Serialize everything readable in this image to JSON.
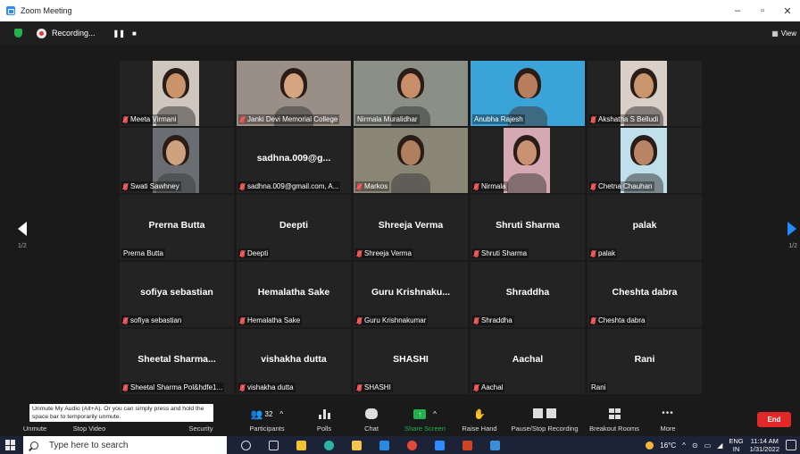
{
  "window": {
    "title": "Zoom Meeting",
    "controls": [
      "–",
      "▫",
      "✕"
    ]
  },
  "meeting_bar": {
    "recording_label": "Recording...",
    "view_label": "View"
  },
  "gallery": {
    "page_left": "1/2",
    "page_right": "1/2",
    "tiles": [
      {
        "big": "",
        "label": "Meeta Virmani",
        "muted": true,
        "video": "narrow",
        "bg": "#cfc6bd",
        "face": "#c9946a"
      },
      {
        "big": "",
        "label": "Janki Devi Memorial College",
        "muted": true,
        "video": "wide",
        "bg": "#9a8f86",
        "face": "#d6a57f"
      },
      {
        "big": "",
        "label": "Nirmala Muralidhar",
        "muted": false,
        "video": "wide",
        "bg": "#8b8f86",
        "face": "#c98d6a",
        "highlight": true
      },
      {
        "big": "",
        "label": "Anubha Rajesh",
        "muted": false,
        "video": "wide",
        "bg": "#3aa3d8",
        "face": "#b67e5d"
      },
      {
        "big": "",
        "label": "Akshatha S Belludi",
        "muted": true,
        "video": "narrow",
        "bg": "#d9cfc7",
        "face": "#c8956c"
      },
      {
        "big": "",
        "label": "Swati Sawhney",
        "muted": true,
        "video": "narrow",
        "bg": "#6a6d72",
        "face": "#cfa27f"
      },
      {
        "big": "sadhna.009@g...",
        "label": "sadhna.009@gmail.com, A...",
        "muted": true,
        "video": "none"
      },
      {
        "big": "",
        "label": "Markos",
        "muted": true,
        "video": "wide",
        "bg": "#8a8676",
        "face": "#b07f5f"
      },
      {
        "big": "",
        "label": "Nirmala",
        "muted": true,
        "video": "narrow",
        "bg": "#d6a8b3",
        "face": "#c99273"
      },
      {
        "big": "",
        "label": "Chetna Chauhan",
        "muted": true,
        "video": "narrow",
        "bg": "#bfe0ea",
        "face": "#b98566"
      },
      {
        "big": "Prerna Butta",
        "label": "Prerna Butta",
        "muted": false,
        "video": "none"
      },
      {
        "big": "Deepti",
        "label": "Deepti",
        "muted": true,
        "video": "none"
      },
      {
        "big": "Shreeja Verma",
        "label": "Shreeja Verma",
        "muted": true,
        "video": "none"
      },
      {
        "big": "Shruti Sharma",
        "label": "Shruti Sharma",
        "muted": true,
        "video": "none"
      },
      {
        "big": "palak",
        "label": "palak",
        "muted": true,
        "video": "none"
      },
      {
        "big": "sofiya sebastian",
        "label": "sofiya sebastian",
        "muted": true,
        "video": "none"
      },
      {
        "big": "Hemalatha Sake",
        "label": "Hemalatha Sake",
        "muted": true,
        "video": "none"
      },
      {
        "big": "Guru Krishnaku...",
        "label": "Guru Krishnakumar",
        "muted": true,
        "video": "none"
      },
      {
        "big": "Shraddha",
        "label": "Shraddha",
        "muted": true,
        "video": "none"
      },
      {
        "big": "Cheshta dabra",
        "label": "Cheshta dabra",
        "muted": true,
        "video": "none"
      },
      {
        "big": "Sheetal Sharma...",
        "label": "Sheetal Sharma Pol&hdfe1...",
        "muted": true,
        "video": "none"
      },
      {
        "big": "vishakha dutta",
        "label": "vishakha dutta",
        "muted": true,
        "video": "none"
      },
      {
        "big": "SHASHI",
        "label": "SHASHI",
        "muted": true,
        "video": "none"
      },
      {
        "big": "Aachal",
        "label": "Aachal",
        "muted": true,
        "video": "none"
      },
      {
        "big": "Rani",
        "label": "Rani",
        "muted": false,
        "video": "none"
      }
    ]
  },
  "toolbar": {
    "tooltip": "Unmute My Audio (Alt+A). Or you can simply press and hold the space bar to temporarily unmute.",
    "unmute": "Unmute",
    "stop_video": "Stop Video",
    "security": "Security",
    "participants": "Participants",
    "participants_count": "32",
    "polls": "Polls",
    "chat": "Chat",
    "share_screen": "Share Screen",
    "raise_hand": "Raise Hand",
    "pause_stop_recording": "Pause/Stop Recording",
    "breakout_rooms": "Breakout Rooms",
    "more": "More",
    "end": "End",
    "share_color": "#23b14d",
    "end_color": "#e02828"
  },
  "taskbar": {
    "search_placeholder": "Type here to search",
    "temperature": "16°C",
    "language": "ENG",
    "region": "IN",
    "time": "11:14 AM",
    "date": "1/31/2022"
  }
}
